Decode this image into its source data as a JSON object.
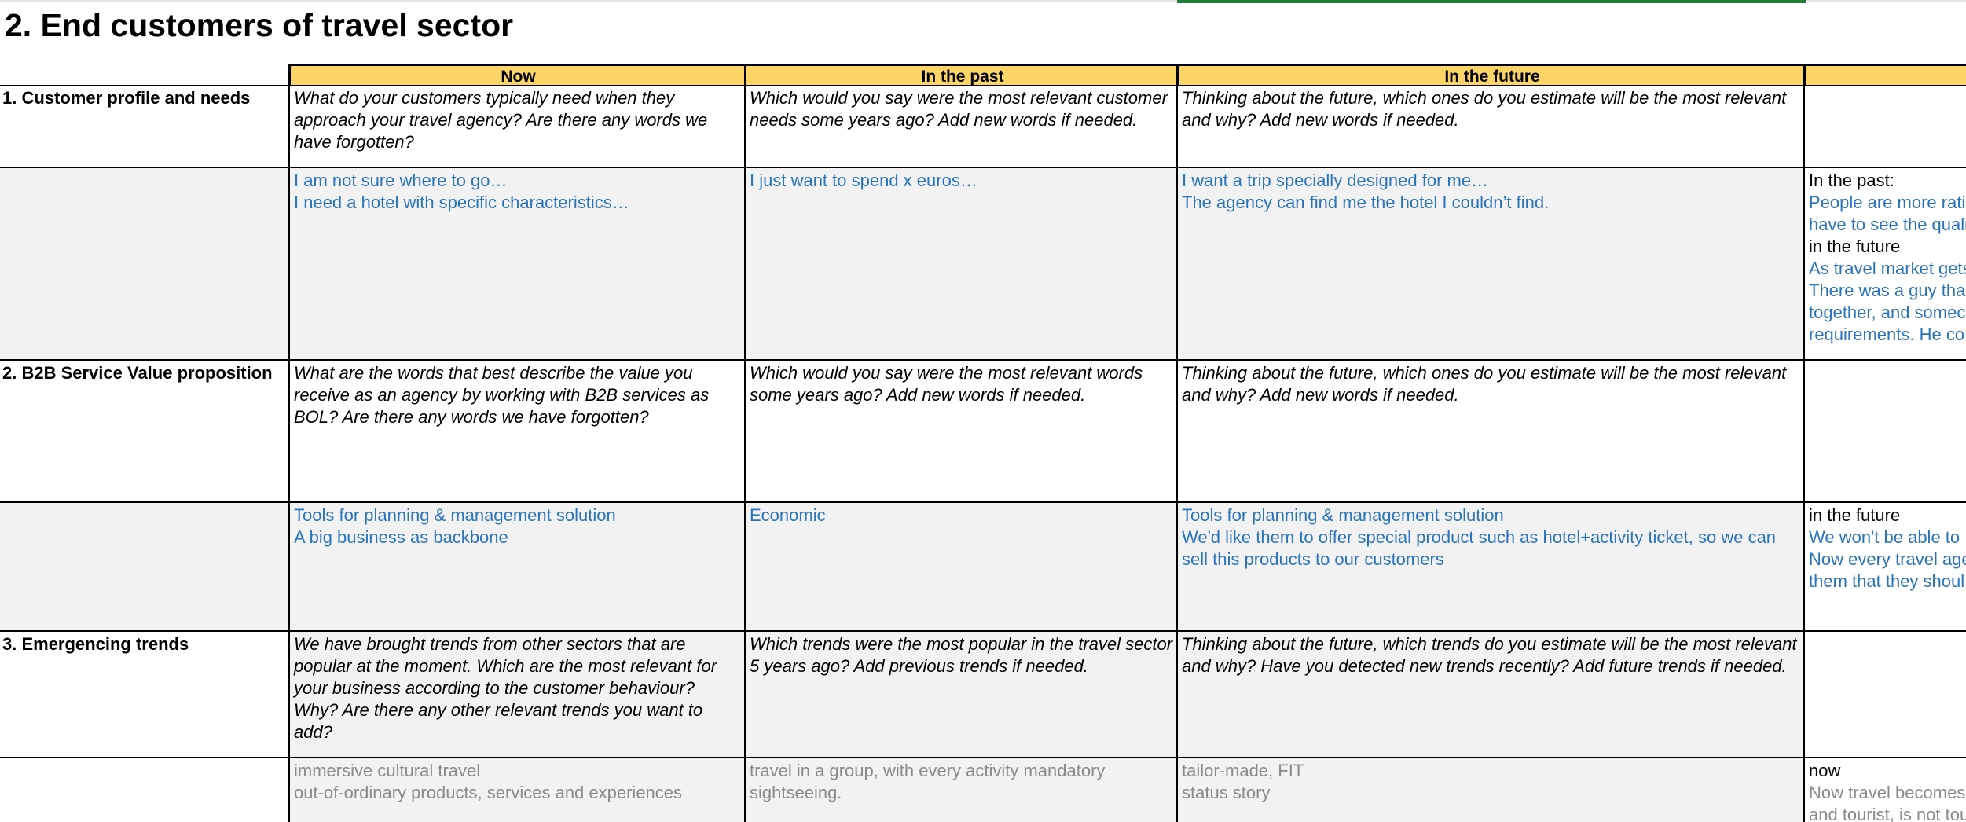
{
  "sheet_title": "2. End customers of travel sector",
  "columns": {
    "now": "Now",
    "past": "In the past",
    "future": "In the future"
  },
  "sections": [
    {
      "label": "1. Customer profile and needs",
      "questions": {
        "now": "What do your customers typically need when they approach your travel agency?  Are there any words we have forgotten?",
        "past": "Which would you say were the most relevant customer needs some years ago? Add new words if needed.",
        "future": "Thinking about the future, which ones do you estimate will be the most relevant and why? Add new words if needed."
      },
      "answers": {
        "now": [
          "I am not sure where to go…",
          "I need a hotel with specific characteristics…"
        ],
        "past": [
          "I just want to spend x euros…"
        ],
        "future": [
          "I want a trip specially designed for me…",
          "The agency can find me the hotel I couldn’t find."
        ]
      },
      "notes": [
        {
          "text": "In the past:",
          "style": "black"
        },
        {
          "text": "People are more rati",
          "style": "blue"
        },
        {
          "text": "have to see the quali",
          "style": "blue"
        },
        {
          "text": "in the future",
          "style": "black"
        },
        {
          "text": "As travel market gets",
          "style": "blue"
        },
        {
          "text": "There was a guy tha",
          "style": "blue"
        },
        {
          "text": "together, and somec",
          "style": "blue"
        },
        {
          "text": "requirements. He co",
          "style": "blue"
        }
      ]
    },
    {
      "label": "2. B2B Service Value proposition",
      "questions": {
        "now": "What are the words that best describe the value you receive as an agency by working with B2B services as BOL?  Are there any words we have forgotten?",
        "past": "Which would you say were the most relevant words some years ago? Add new words if needed.",
        "future": "Thinking about the future, which ones do you estimate will be the most relevant and why? Add new words if needed."
      },
      "answers": {
        "now": [
          "Tools for planning & management solution",
          "A big business as backbone"
        ],
        "past": [
          "Economic"
        ],
        "future": [
          "Tools for planning & management solution",
          "We'd like them to offer special product such as hotel+activity ticket, so we can",
          "sell this products to our customers"
        ]
      },
      "notes": [
        {
          "text": "in the future",
          "style": "black"
        },
        {
          "text": "We won't be able to",
          "style": "blue"
        },
        {
          "text": "Now every travel age",
          "style": "blue"
        },
        {
          "text": "them that they shoul",
          "style": "blue"
        }
      ]
    },
    {
      "label": "3. Emergencing trends",
      "questions": {
        "now": "We have brought trends from other sectors that are popular at the moment. Which are the most relevant for your business according to the customer behaviour? Why? Are there any other relevant trends you want to add?",
        "past": "Which trends were the most popular in the travel sector 5 years ago? Add previous trends if needed.",
        "future": "Thinking about the future, which trends do you estimate will be the most relevant and why? Have you detected new trends recently? Add future trends if needed."
      },
      "answers": {
        "now": [
          "immersive cultural travel",
          "out-of-ordinary products, services and experiences"
        ],
        "past": [
          "travel in a group, with every activity mandatory",
          "sightseeing."
        ],
        "future": [
          "tailor-made, FIT",
          "status story"
        ]
      },
      "notes": [
        {
          "text": "now",
          "style": "black"
        },
        {
          "text": "Now travel becomes",
          "style": "gray"
        },
        {
          "text": "and tourist, is not tou",
          "style": "gray"
        }
      ]
    }
  ]
}
